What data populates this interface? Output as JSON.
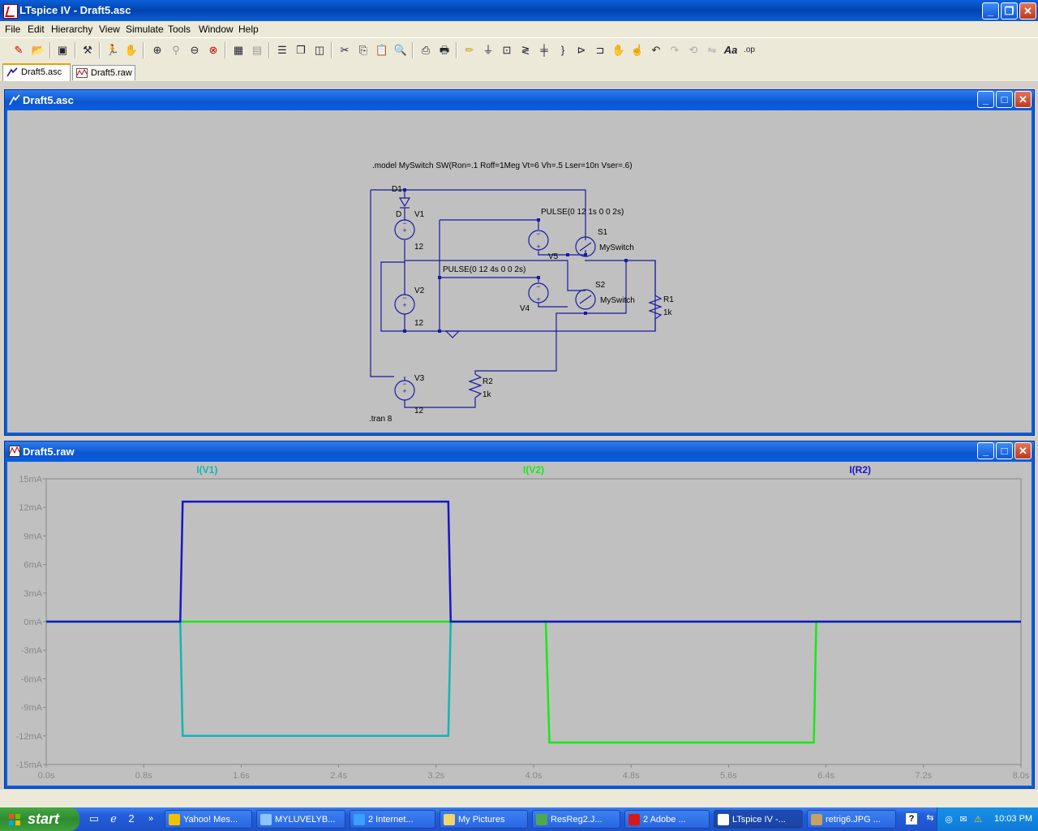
{
  "window": {
    "title": "LTspice IV - Draft5.asc"
  },
  "menu": [
    "File",
    "Edit",
    "Hierarchy",
    "View",
    "Simulate",
    "Tools",
    "Window",
    "Help"
  ],
  "tabs": [
    {
      "label": "Draft5.asc",
      "icon": "schematic-icon"
    },
    {
      "label": "Draft5.raw",
      "icon": "waveform-icon"
    }
  ],
  "schematic": {
    "title": "Draft5.asc",
    "model_text": ".model MySwitch SW(Ron=.1 Roff=1Meg Vt=6 Vh=.5 Lser=10n Vser=.6)",
    "tran_text": ".tran 8",
    "pulse1": "PULSE(0 12 1s 0 0 2s)",
    "pulse2": "PULSE(0 12 4s 0 0 2s)",
    "labels": {
      "D1": "D1",
      "D": "D",
      "V1": "V1",
      "V1_val": "12",
      "V2": "V2",
      "V2_val": "12",
      "V3": "V3",
      "V3_val": "12",
      "V4": "V4",
      "V5": "V5",
      "S1": "S1",
      "S2": "S2",
      "S1_model": "MySwitch",
      "S2_model": "MySwitch",
      "R1": "R1",
      "R1_val": "1k",
      "R2": "R2",
      "R2_val": "1k"
    }
  },
  "waveform": {
    "title": "Draft5.raw",
    "traces": [
      {
        "name": "I(V1)",
        "color": "#14b4b4"
      },
      {
        "name": "I(V2)",
        "color": "#17e817"
      },
      {
        "name": "I(R2)",
        "color": "#1616c8"
      }
    ]
  },
  "chart_data": {
    "type": "line",
    "xlabel": "",
    "ylabel": "",
    "x_ticks": [
      "0.0s",
      "0.8s",
      "1.6s",
      "2.4s",
      "3.2s",
      "4.0s",
      "4.8s",
      "5.6s",
      "6.4s",
      "7.2s",
      "8.0s"
    ],
    "y_ticks": [
      "15mA",
      "12mA",
      "9mA",
      "6mA",
      "3mA",
      "0mA",
      "-3mA",
      "-6mA",
      "-9mA",
      "-12mA",
      "-15mA"
    ],
    "xlim": [
      0,
      8
    ],
    "ylim": [
      -15,
      15
    ],
    "grid": false,
    "series": [
      {
        "name": "I(V1)",
        "color": "#14b4b4",
        "x": [
          0,
          1.1,
          1.12,
          3.3,
          3.32,
          8
        ],
        "y": [
          0,
          0,
          -12,
          -12,
          0,
          0
        ]
      },
      {
        "name": "I(V2)",
        "color": "#17e817",
        "x": [
          0,
          4.1,
          4.13,
          6.3,
          6.32,
          8
        ],
        "y": [
          0,
          0,
          -12.7,
          -12.7,
          0,
          0
        ]
      },
      {
        "name": "I(R2)",
        "color": "#1616c8",
        "x": [
          0,
          1.1,
          1.12,
          3.3,
          3.32,
          8
        ],
        "y": [
          0,
          0,
          12.6,
          12.6,
          0,
          0
        ]
      }
    ]
  },
  "taskbar": {
    "start": "start",
    "tasks": [
      {
        "label": "Yahoo! Mes...",
        "icon": "yahoo-icon",
        "color": "#f2c100"
      },
      {
        "label": "MYLUVELYB...",
        "icon": "chat-icon",
        "color": "#8fc3ff"
      },
      {
        "label": "2 Internet...",
        "icon": "ie-icon",
        "color": "#3aa0ff"
      },
      {
        "label": "My Pictures",
        "icon": "folder-icon",
        "color": "#f3d36b"
      },
      {
        "label": "ResReg2.J...",
        "icon": "image-icon",
        "color": "#4ea84e"
      },
      {
        "label": "2 Adobe ...",
        "icon": "adobe-icon",
        "color": "#d31b1b"
      },
      {
        "label": "LTspice IV -...",
        "icon": "ltspice-icon",
        "color": "#ffffff"
      },
      {
        "label": "retrig6.JPG ...",
        "icon": "paint-icon",
        "color": "#c9a060"
      }
    ],
    "clock": "10:03 PM"
  }
}
